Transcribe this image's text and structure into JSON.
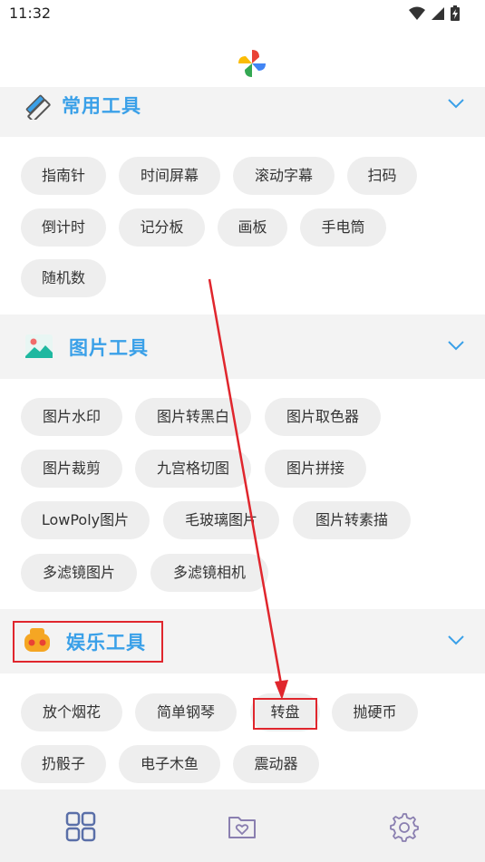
{
  "status": {
    "time": "11:32"
  },
  "sections": [
    {
      "title": "常用工具",
      "icon": "ruler-pencil-icon",
      "items": [
        "指南针",
        "时间屏幕",
        "滚动字幕",
        "扫码",
        "倒计时",
        "记分板",
        "画板",
        "手电筒",
        "随机数"
      ]
    },
    {
      "title": "图片工具",
      "icon": "image-landscape-icon",
      "items": [
        "图片水印",
        "图片转黑白",
        "图片取色器",
        "图片裁剪",
        "九宫格切图",
        "图片拼接",
        "LowPoly图片",
        "毛玻璃图片",
        "图片转素描",
        "多滤镜图片",
        "多滤镜相机"
      ]
    },
    {
      "title": "娱乐工具",
      "icon": "game-controller-icon",
      "items": [
        "放个烟花",
        "简单钢琴",
        "转盘",
        "抛硬币",
        "扔骰子",
        "电子木鱼",
        "震动器"
      ]
    }
  ],
  "nav": [
    {
      "icon": "grid-apps-icon",
      "active": true
    },
    {
      "icon": "folder-heart-icon",
      "active": false
    },
    {
      "icon": "gear-icon",
      "active": false
    }
  ],
  "colors": {
    "accent": "#3aa0e8",
    "annotation": "#e0262d",
    "chip_bg": "#eeeeee",
    "header_bg": "#f3f3f3"
  }
}
